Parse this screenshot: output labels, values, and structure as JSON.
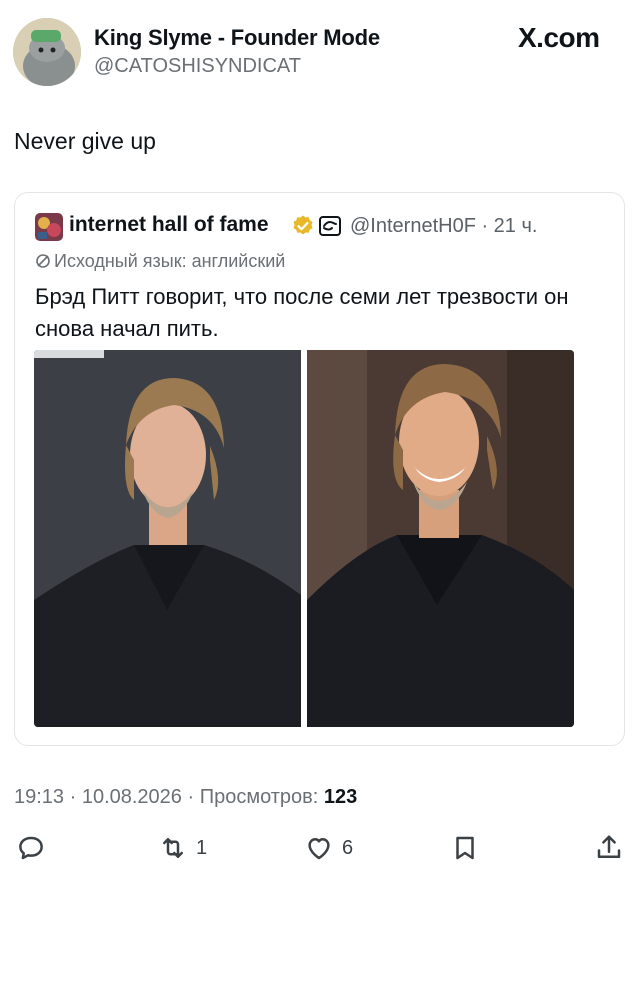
{
  "author": {
    "name": "King Slyme - Founder Mode",
    "handle": "@CATOSHISYNDICAT"
  },
  "brand": "X.com",
  "tweet": {
    "text": "Never give up"
  },
  "quote": {
    "name": "internet hall of fame",
    "handle_time": "@InternetH0F · 21 ч.",
    "language_note": "Исходный язык: английский",
    "text": "Брэд Питт говорит, что после семи лет трезвости он снова начал пить."
  },
  "meta": {
    "time": "19:13 · 10.08.2026 · ",
    "views_label": "Просмотров: ",
    "views": "123"
  },
  "actions": {
    "reposts": "1",
    "likes": "6"
  },
  "colors": {
    "verified": "#e8b829",
    "text": "#0f1419",
    "muted": "#6b7075"
  }
}
